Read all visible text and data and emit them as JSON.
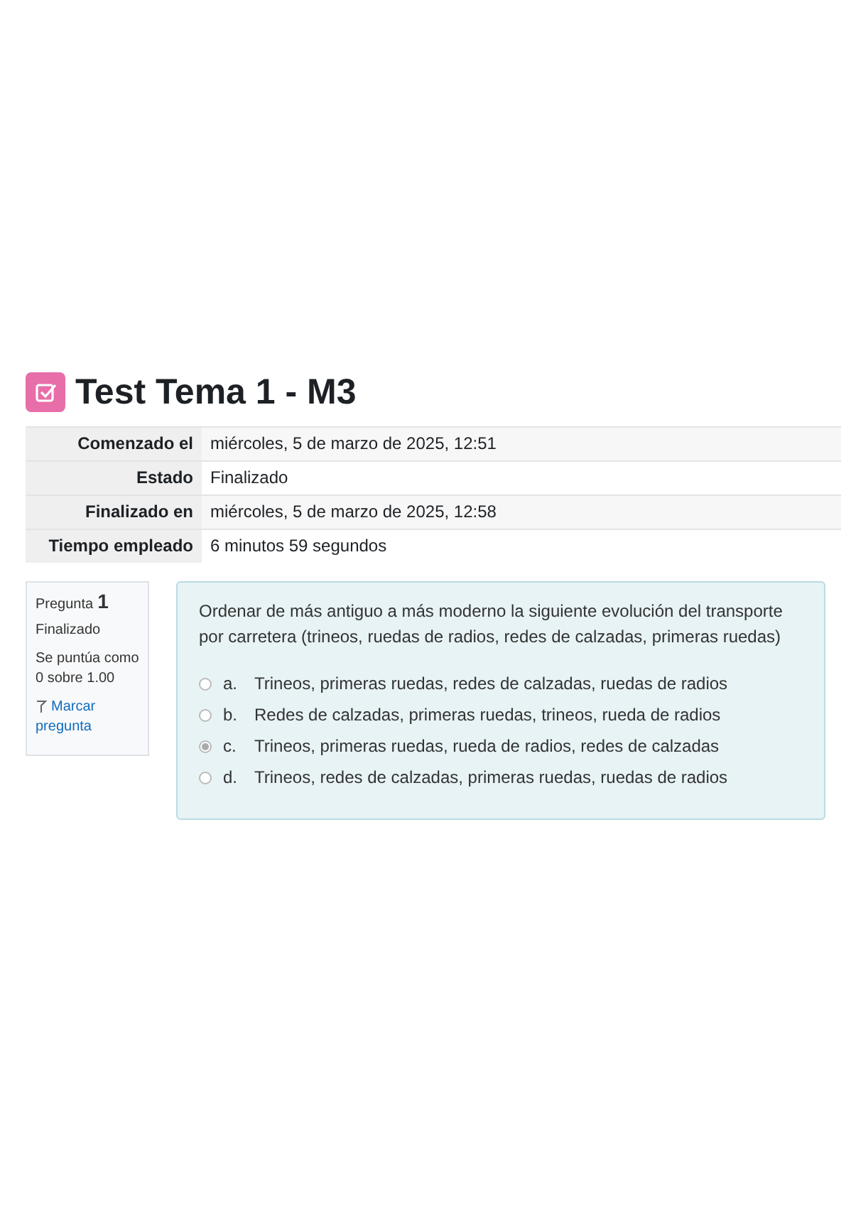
{
  "title": "Test Tema 1 - M3",
  "summary": [
    {
      "label": "Comenzado el",
      "value": "miércoles, 5 de marzo de 2025, 12:51"
    },
    {
      "label": "Estado",
      "value": "Finalizado"
    },
    {
      "label": "Finalizado en",
      "value": "miércoles, 5 de marzo de 2025, 12:58"
    },
    {
      "label": "Tiempo empleado",
      "value": "6 minutos 59 segundos"
    }
  ],
  "question_info": {
    "label": "Pregunta",
    "number": "1",
    "state": "Finalizado",
    "grade": "Se puntúa como 0 sobre 1.00",
    "flag_link": "Marcar pregunta"
  },
  "question": {
    "text": "Ordenar de más antiguo a más moderno la siguiente evolución del transporte por carretera (trineos, ruedas de radios, redes de calzadas, primeras ruedas)",
    "options": [
      {
        "letter": "a.",
        "text": "Trineos, primeras ruedas, redes de calzadas, ruedas de radios",
        "selected": false
      },
      {
        "letter": "b.",
        "text": "Redes de calzadas, primeras ruedas, trineos, rueda de radios",
        "selected": false
      },
      {
        "letter": "c.",
        "text": "Trineos, primeras ruedas, rueda de radios, redes de calzadas",
        "selected": true
      },
      {
        "letter": "d.",
        "text": "Trineos, redes de calzadas, primeras ruedas, ruedas de radios",
        "selected": false
      }
    ]
  }
}
